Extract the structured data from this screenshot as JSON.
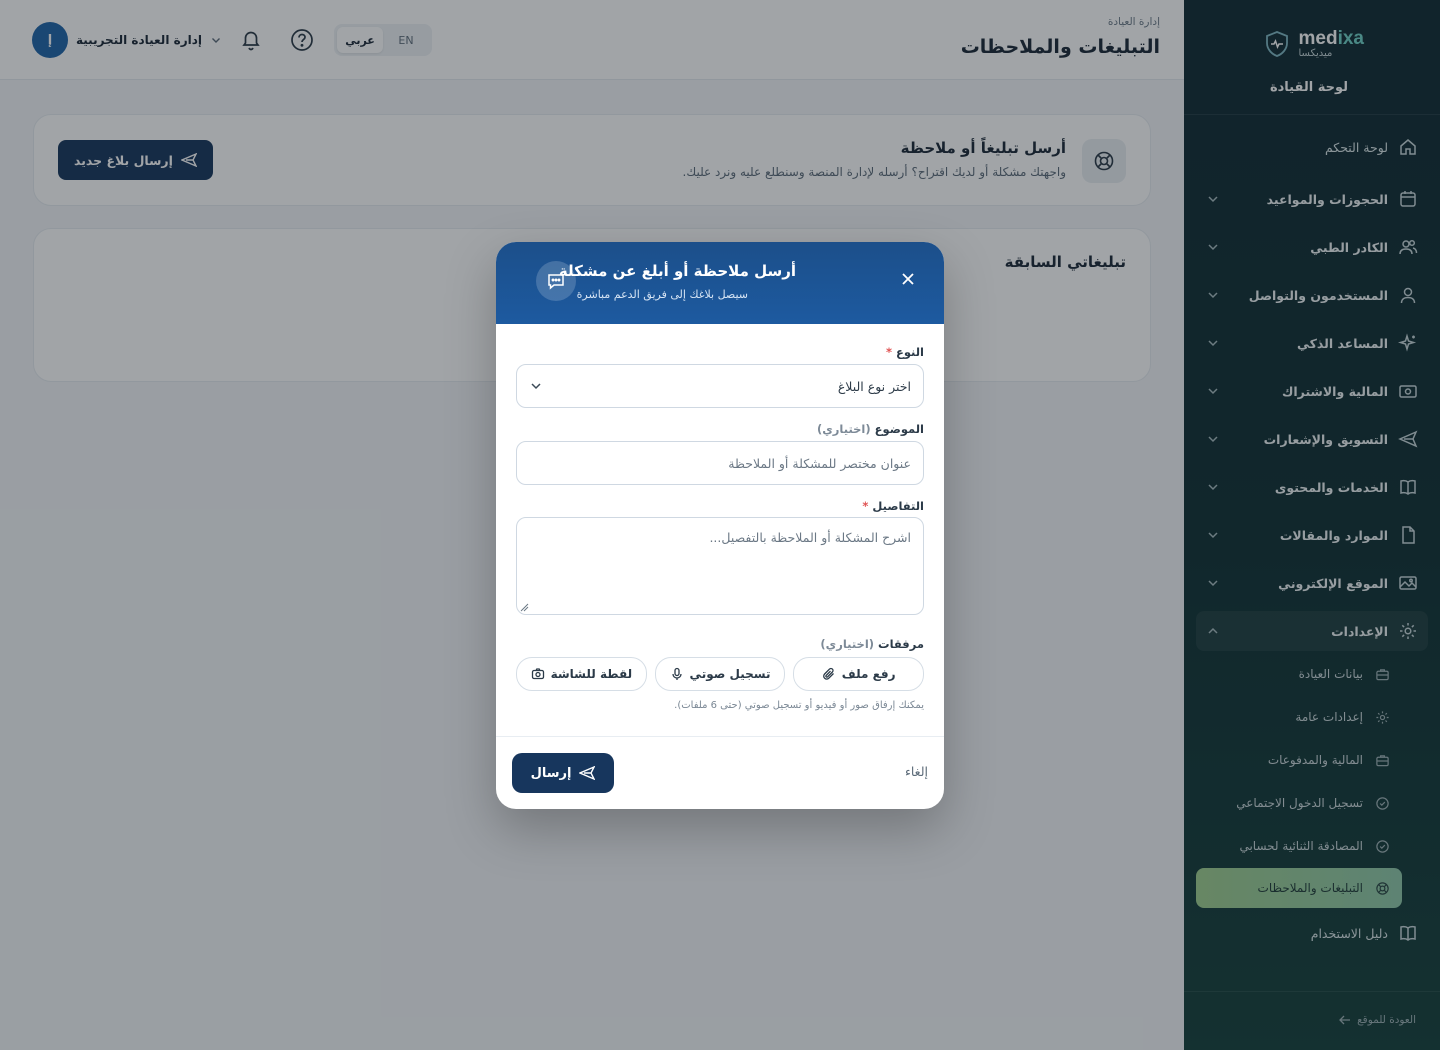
{
  "brand": {
    "name_a": "med",
    "name_b": "ixa",
    "sub": "ميديكسا"
  },
  "sidebar": {
    "heading": "لوحة القيادة",
    "items": [
      {
        "label": "لوحة التحكم",
        "icon": "home-icon"
      },
      {
        "label": "الحجوزات والمواعيد",
        "icon": "calendar-icon"
      },
      {
        "label": "الكادر الطبي",
        "icon": "users-icon"
      },
      {
        "label": "المستخدمون والتواصل",
        "icon": "user-icon"
      },
      {
        "label": "المساعد الذكي",
        "icon": "sparkles-icon"
      },
      {
        "label": "المالية والاشتراك",
        "icon": "banknote-icon"
      },
      {
        "label": "التسويق والإشعارات",
        "icon": "send-icon"
      },
      {
        "label": "الخدمات والمحتوى",
        "icon": "book-icon"
      },
      {
        "label": "الموارد والمقالات",
        "icon": "file-icon"
      },
      {
        "label": "الموقع الإلكتروني",
        "icon": "image-icon"
      },
      {
        "label": "الإعدادات",
        "icon": "gear-icon"
      }
    ],
    "settings_sub": [
      {
        "label": "بيانات العيادة",
        "icon": "briefcase-icon"
      },
      {
        "label": "إعدادات عامة",
        "icon": "gear-icon"
      },
      {
        "label": "المالية والمدفوعات",
        "icon": "briefcase-icon"
      },
      {
        "label": "تسجيل الدخول الاجتماعي",
        "icon": "check-circle-icon"
      },
      {
        "label": "المصادقة الثنائية لحسابي",
        "icon": "check-circle-icon"
      },
      {
        "label": "التبليغات والملاحظات",
        "icon": "lifebuoy-icon"
      }
    ],
    "guide": {
      "label": "دليل الاستخدام",
      "icon": "book-open-icon"
    },
    "back": "العودة للموقع"
  },
  "topbar": {
    "breadcrumb": "إدارة العيادة",
    "title": "التبليغات والملاحظات",
    "lang_ar": "عربي",
    "lang_en": "EN",
    "user_initial": "إ",
    "user_name": "إدارة العيادة التجريبية"
  },
  "intro_card": {
    "title": "أرسل تبليغاً أو ملاحظة",
    "desc": "واجهتك مشكلة أو لديك اقتراح؟ أرسله لإدارة المنصة وسنطلع عليه ونرد عليك.",
    "button": "إرسال بلاغ جديد"
  },
  "history_card": {
    "title": "تبليغاتي السابقة"
  },
  "modal": {
    "title": "أرسل ملاحظة أو أبلغ عن مشكلة",
    "subtitle": "سيصل بلاغك إلى فريق الدعم مباشرة",
    "type_label": "النوع",
    "required_mark": "*",
    "type_value": "اختر نوع البلاغ",
    "subject_label": "الموضوع",
    "subject_optional": "(اختياري)",
    "subject_placeholder": "عنوان مختصر للمشكلة أو الملاحظة",
    "details_label": "التفاصيل",
    "details_placeholder": "اشرح المشكلة أو الملاحظة بالتفصيل...",
    "attachments_label": "مرفقات",
    "attachments_optional": "(اختياري)",
    "att_screenshot": "لقطة للشاشة",
    "att_voice": "تسجيل صوتي",
    "att_file": "رفع ملف",
    "att_hint": "يمكنك إرفاق صور أو فيديو أو تسجيل صوتي (حتى 6 ملفات).",
    "send": "إرسال",
    "cancel": "إلغاء"
  },
  "colors": {
    "sidebar_bg": "#102a33",
    "primary": "#17365d",
    "modal_header": "#1d5aa0",
    "active_item": "#9fcf8f",
    "required": "#e05353"
  }
}
